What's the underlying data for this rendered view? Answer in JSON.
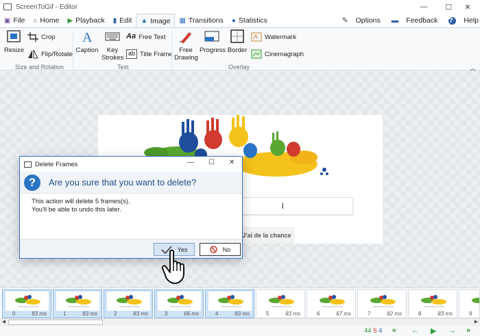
{
  "window": {
    "title": "ScreenToGif - Editor",
    "controls": {
      "minimize": "—",
      "maximize": "☐",
      "close": "✕"
    }
  },
  "tabs": [
    {
      "label": "File",
      "icon": "save-icon"
    },
    {
      "label": "Home",
      "icon": "home-icon"
    },
    {
      "label": "Playback",
      "icon": "play-icon"
    },
    {
      "label": "Edit",
      "icon": "edit-icon"
    },
    {
      "label": "Image",
      "icon": "image-icon",
      "active": true
    },
    {
      "label": "Transitions",
      "icon": "transitions-icon"
    },
    {
      "label": "Statistics",
      "icon": "info-icon"
    }
  ],
  "header_right": {
    "options": "Options",
    "feedback": "Feedback",
    "help": "Help"
  },
  "ribbon": {
    "resize": "Resize",
    "crop": "Crop",
    "flip_rotate": "Flip/Rotate",
    "caption": "Caption",
    "key_strokes_1": "Key",
    "key_strokes_2": "Strokes",
    "free_text": "Free Text",
    "title_frame": "Title Frame",
    "free_drawing_1": "Free",
    "free_drawing_2": "Drawing",
    "progress": "Progress",
    "border": "Border",
    "watermark": "Watermark",
    "cinemagraph": "Cinemagraph",
    "group_size_rotation": "Size and Rotation",
    "group_text": "Text",
    "group_overlay": "Overlay"
  },
  "canvas": {
    "lucky_button": "J'ai de la chance"
  },
  "dialog": {
    "title": "Delete Frames",
    "question": "Are you sure that you want to delete?",
    "line1": "This action will delete 5 frames(s).",
    "line2": "You'll be able to undo this later.",
    "yes": "Yes",
    "no": "No",
    "controls": {
      "minimize": "—",
      "maximize": "☐",
      "close": "✕"
    }
  },
  "frames": [
    {
      "num": "0",
      "ms": "83 ms",
      "selected": true
    },
    {
      "num": "1",
      "ms": "83 ms",
      "selected": true
    },
    {
      "num": "2",
      "ms": "83 ms",
      "selected": true
    },
    {
      "num": "3",
      "ms": "66 ms",
      "selected": true
    },
    {
      "num": "4",
      "ms": "83 ms",
      "selected": true
    },
    {
      "num": "5",
      "ms": "83 ms",
      "selected": false
    },
    {
      "num": "6",
      "ms": "67 ms",
      "selected": false
    },
    {
      "num": "7",
      "ms": "82 ms",
      "selected": false
    },
    {
      "num": "8",
      "ms": "83 ms",
      "selected": false
    },
    {
      "num": "9",
      "ms": "",
      "selected": false
    }
  ],
  "status": {
    "total_frames": "44",
    "selected_frames": "5",
    "current_frame": "4"
  },
  "colors": {
    "accent": "#2b73c4",
    "selected_frame": "#cfe3f7",
    "green": "#2e9b36",
    "red": "#d03a2f"
  }
}
